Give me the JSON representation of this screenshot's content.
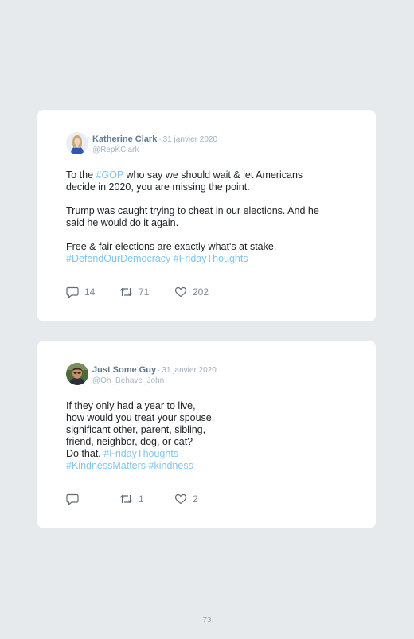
{
  "tweets": [
    {
      "author": "Katherine Clark",
      "date": "31 janvier 2020",
      "handle": "@RepKClark",
      "body": {
        "p1_l1_a": "To the ",
        "p1_l1_tag": "#GOP",
        "p1_l1_b": " who say we should wait & let Americans",
        "p1_l2": "decide in 2020, you are missing the point.",
        "p2_l1": "Trump was caught trying to cheat in our elections. And he",
        "p2_l2": "said he would do it again.",
        "p3_l1": "Free & fair elections are exactly what's at stake.",
        "p3_tag1": "#DefendOurDemocracy",
        "p3_tag2": "#FridayThoughts"
      },
      "replies": "14",
      "retweets": "71",
      "likes": "202"
    },
    {
      "author": "Just Some Guy",
      "date": "31 janvier 2020",
      "handle": "@Oh_Behave_John",
      "body": {
        "l1": "If they only had a year to live,",
        "l2": "how would you treat your spouse,",
        "l3": "significant other, parent, sibling,",
        "l4": "friend, neighbor, dog, or cat?",
        "l5_a": "Do that. ",
        "l5_tag": "#FridayThoughts",
        "l6_tag1": "#KindnessMatters",
        "l6_tag2": "#kindness"
      },
      "replies": "",
      "retweets": "1",
      "likes": "2"
    }
  ],
  "icons": {
    "reply": "speech-bubble-icon",
    "retweet": "retweet-arrows-icon",
    "like": "heart-outline-icon"
  },
  "colors": {
    "background": "#e7eaec",
    "card": "#ffffff",
    "hashtag": "#7fc6ef",
    "author": "#61798e",
    "muted": "#9fb0bf"
  },
  "page_number": "73"
}
